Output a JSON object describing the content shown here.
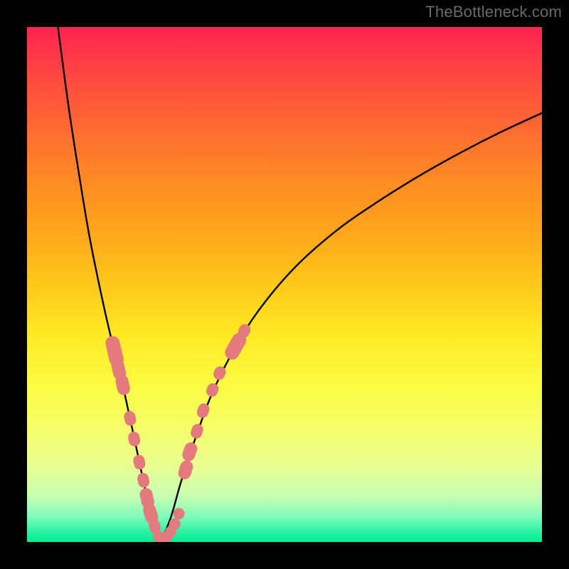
{
  "watermark": "TheBottleneck.com",
  "colors": {
    "page_bg": "#000000",
    "curve": "#000000",
    "marker": "#e47a7e",
    "watermark_text": "#6a6a6a",
    "gradient_top": "#fe2453",
    "gradient_bottom": "#00ee98"
  },
  "chart_data": {
    "type": "line",
    "title": "",
    "xlabel": "",
    "ylabel": "",
    "xlim": [
      0,
      100
    ],
    "ylim": [
      0,
      100
    ],
    "left_branch": {
      "x": [
        6,
        8,
        10,
        12,
        14,
        16,
        18,
        20,
        21.5,
        23,
        24.5,
        26
      ],
      "y": [
        100,
        85,
        72,
        60,
        50,
        41,
        33,
        24,
        17,
        10,
        4,
        0
      ]
    },
    "right_branch": {
      "x": [
        26,
        28,
        30,
        33,
        36,
        40,
        45,
        52,
        60,
        68,
        76,
        84,
        92,
        100
      ],
      "y": [
        0,
        5,
        12,
        21,
        29,
        37,
        45,
        53.3,
        60.4,
        66,
        71,
        75.5,
        79.6,
        83.3
      ]
    },
    "dip_x": 26,
    "markers_left": [
      {
        "x": 17.0,
        "y": 37.0,
        "size": 10,
        "elong": 2.2
      },
      {
        "x": 17.8,
        "y": 33.5,
        "size": 9,
        "elong": 1.6
      },
      {
        "x": 18.6,
        "y": 30.5,
        "size": 9,
        "elong": 1.6
      },
      {
        "x": 20.0,
        "y": 24.0,
        "size": 8,
        "elong": 1.3
      },
      {
        "x": 20.8,
        "y": 20.0,
        "size": 8,
        "elong": 1.3
      },
      {
        "x": 21.8,
        "y": 15.5,
        "size": 8,
        "elong": 1.3
      },
      {
        "x": 22.6,
        "y": 12.0,
        "size": 8,
        "elong": 1.3
      },
      {
        "x": 23.3,
        "y": 8.5,
        "size": 9,
        "elong": 1.6
      },
      {
        "x": 24.0,
        "y": 5.5,
        "size": 9,
        "elong": 1.6
      },
      {
        "x": 24.8,
        "y": 3.0,
        "size": 8,
        "elong": 1.2
      }
    ],
    "markers_right": [
      {
        "x": 30.8,
        "y": 14.0,
        "size": 9,
        "elong": 1.5
      },
      {
        "x": 31.6,
        "y": 17.5,
        "size": 9,
        "elong": 1.5
      },
      {
        "x": 33.0,
        "y": 21.5,
        "size": 8,
        "elong": 1.3
      },
      {
        "x": 34.2,
        "y": 25.5,
        "size": 8,
        "elong": 1.3
      },
      {
        "x": 36.0,
        "y": 29.5,
        "size": 8,
        "elong": 1.2
      },
      {
        "x": 37.4,
        "y": 32.8,
        "size": 8,
        "elong": 1.2
      },
      {
        "x": 40.5,
        "y": 38.0,
        "size": 10,
        "elong": 2.0
      },
      {
        "x": 42.2,
        "y": 41.0,
        "size": 8,
        "elong": 1.2
      }
    ],
    "markers_bottom": [
      {
        "x": 25.5,
        "y": 1.0,
        "size": 8,
        "elong": 1.0
      },
      {
        "x": 26.3,
        "y": 0.5,
        "size": 8,
        "elong": 1.0
      },
      {
        "x": 27.1,
        "y": 1.0,
        "size": 8,
        "elong": 1.0
      },
      {
        "x": 27.9,
        "y": 2.0,
        "size": 8,
        "elong": 1.0
      },
      {
        "x": 28.7,
        "y": 3.5,
        "size": 8,
        "elong": 1.0
      },
      {
        "x": 29.5,
        "y": 5.5,
        "size": 8,
        "elong": 1.0
      }
    ]
  }
}
